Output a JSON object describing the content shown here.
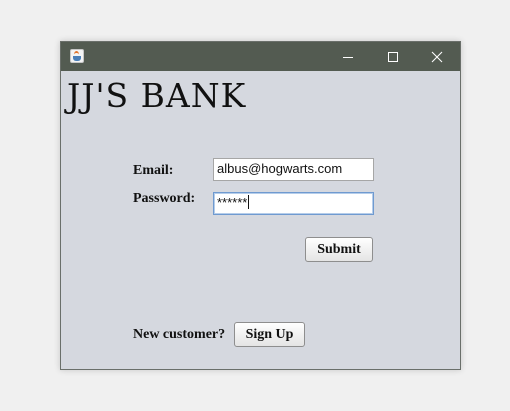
{
  "window": {
    "title": "",
    "icon": "java-coffee-cup-icon",
    "controls": [
      "minimize-icon",
      "maximize-icon",
      "close-icon"
    ]
  },
  "bank": {
    "title": "JJ'S BANK"
  },
  "form": {
    "email_label": "Email:",
    "email_value": "albus@hogwarts.com",
    "password_label": "Password:",
    "password_value": "******",
    "submit_label": "Submit"
  },
  "signup": {
    "prompt": "New customer?",
    "button_label": "Sign Up"
  },
  "colors": {
    "titlebar": "#535b51",
    "window_background": "#d5d8df",
    "focus_border": "#6f9ad0"
  }
}
